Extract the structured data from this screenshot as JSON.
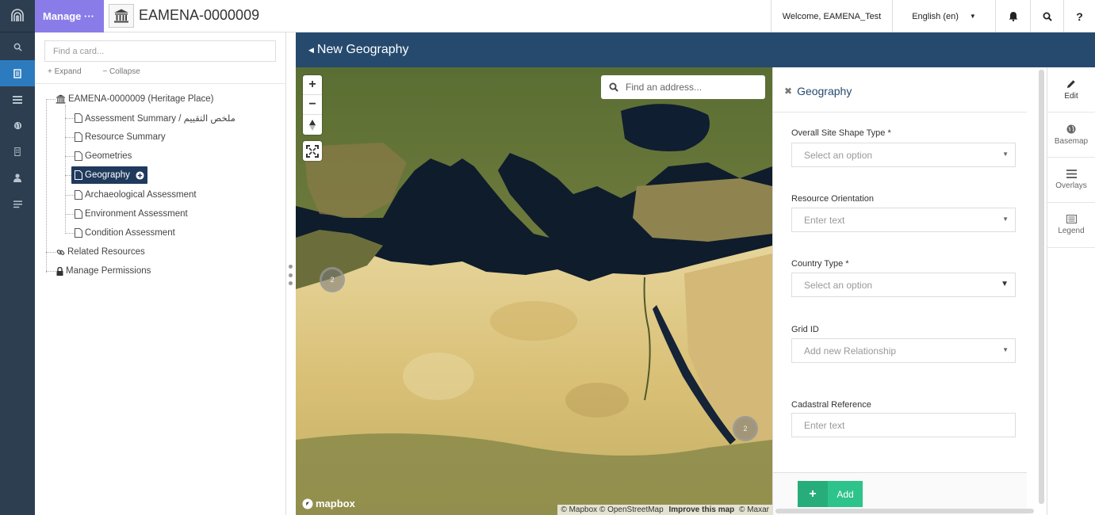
{
  "app": {
    "manage_label": "Manage ···",
    "resource_title": "EAMENA-0000009"
  },
  "topbar": {
    "welcome": "Welcome, EAMENA_Test",
    "language": "English (en)",
    "help": "?"
  },
  "cards": {
    "search_placeholder": "Find a card...",
    "expand_label": "Expand",
    "collapse_label": "Collapse",
    "tree": {
      "root": "EAMENA-0000009 (Heritage Place)",
      "items": [
        "Assessment Summary / ملخص التقييم",
        "Resource Summary",
        "Geometries",
        "Geography",
        "Archaeological Assessment",
        "Environment Assessment",
        "Condition Assessment"
      ],
      "related": "Related Resources",
      "permissions": "Manage Permissions"
    }
  },
  "form": {
    "header": "New Geography"
  },
  "map": {
    "search_placeholder": "Find an address...",
    "zoom_in": "+",
    "zoom_out": "−",
    "cluster_a": "2",
    "cluster_b": "2",
    "logo_text": "mapbox",
    "attribution": "© Mapbox © OpenStreetMap",
    "improve": "Improve this map",
    "maxar": "© Maxar"
  },
  "geography": {
    "title": "Geography",
    "fields": [
      {
        "label": "Overall Site Shape Type",
        "required": "*",
        "placeholder": "Select an option"
      },
      {
        "label": "Resource Orientation",
        "required": "",
        "placeholder": "Enter text"
      },
      {
        "label": "Country Type",
        "required": "*",
        "placeholder": "Select an option"
      },
      {
        "label": "Grid ID",
        "required": "",
        "placeholder": "Add new Relationship"
      },
      {
        "label": "Cadastral Reference",
        "required": "",
        "placeholder": "Enter text"
      }
    ],
    "add_label": "Add",
    "add_symbol": "+"
  },
  "right_rail": {
    "edit": "Edit",
    "basemap": "Basemap",
    "overlays": "Overlays",
    "legend": "Legend"
  },
  "colors": {
    "navy": "#254a6e",
    "manage_purple": "#8a7ce8",
    "add_green": "#2ec38a",
    "rail_dark": "#2d3e50"
  }
}
